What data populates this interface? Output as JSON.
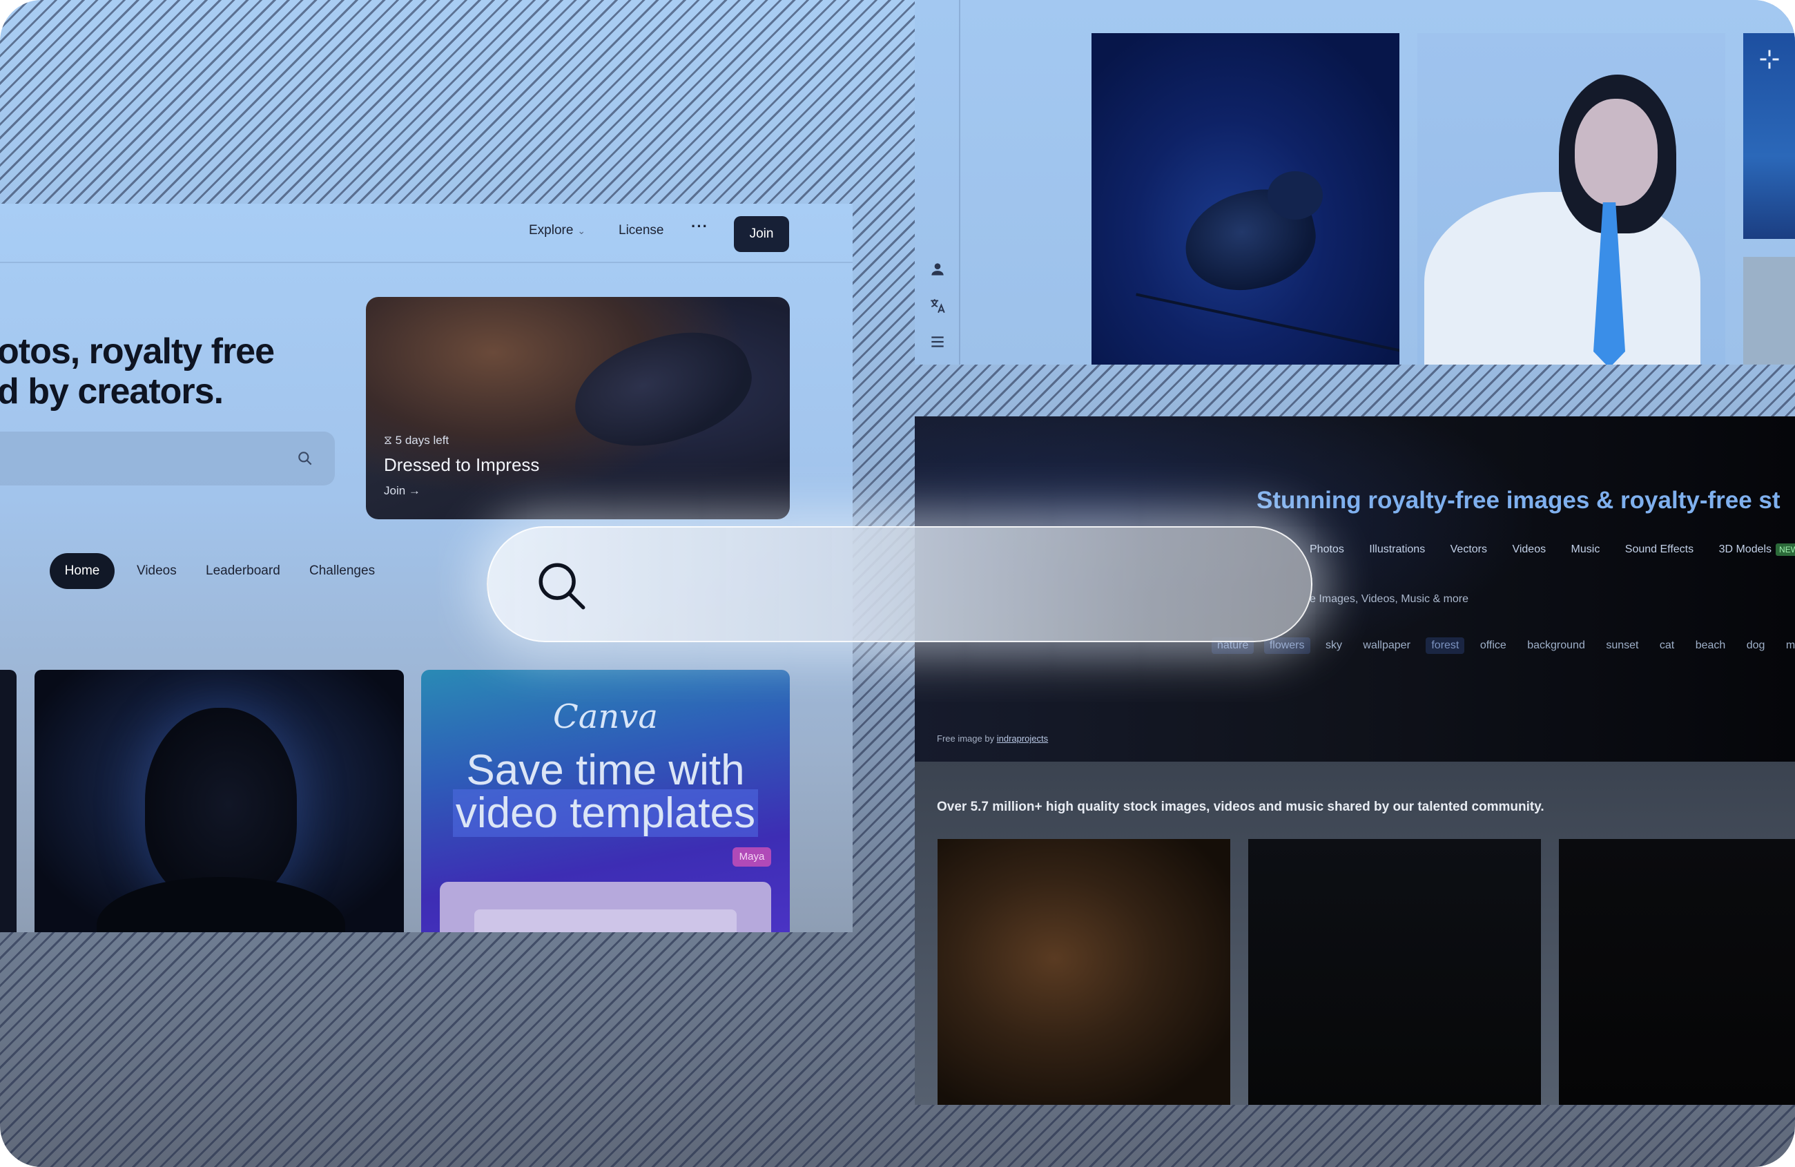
{
  "left_window": {
    "nav": {
      "explore": "Explore",
      "license": "License",
      "more": "···",
      "join": "Join"
    },
    "hero": {
      "line1": "otos, royalty free",
      "line2": "d by creators."
    },
    "challenge": {
      "days_left": "5 days left",
      "title": "Dressed to Impress",
      "join": "Join"
    },
    "tabs": [
      {
        "label": "Home",
        "active": true
      },
      {
        "label": "Videos"
      },
      {
        "label": "Leaderboard"
      },
      {
        "label": "Challenges"
      }
    ],
    "ad": {
      "brand": "Canva",
      "headline_1": "Save time with",
      "headline_2": "video templates",
      "tag": "Maya"
    }
  },
  "top_right_window": {
    "sidebar_icons": [
      "user-icon",
      "translate-icon",
      "menu-icon"
    ]
  },
  "bottom_right_window": {
    "title": "Stunning royalty-free images & royalty-free st",
    "categories": [
      "Photos",
      "Illustrations",
      "Vectors",
      "Videos",
      "Music",
      "Sound Effects",
      "3D Models"
    ],
    "new_badge": "NEW",
    "subtitle": "e Images, Videos, Music & more",
    "tags": [
      "nature",
      "flowers",
      "sky",
      "wallpaper",
      "forest",
      "office",
      "background",
      "sunset",
      "cat",
      "beach",
      "dog",
      "money"
    ],
    "credit_prefix": "Free image by",
    "credit_author": "indraprojects",
    "stats": "Over 5.7 million+ high quality stock images, videos and music shared by our talented community."
  },
  "search": {
    "value": ""
  }
}
